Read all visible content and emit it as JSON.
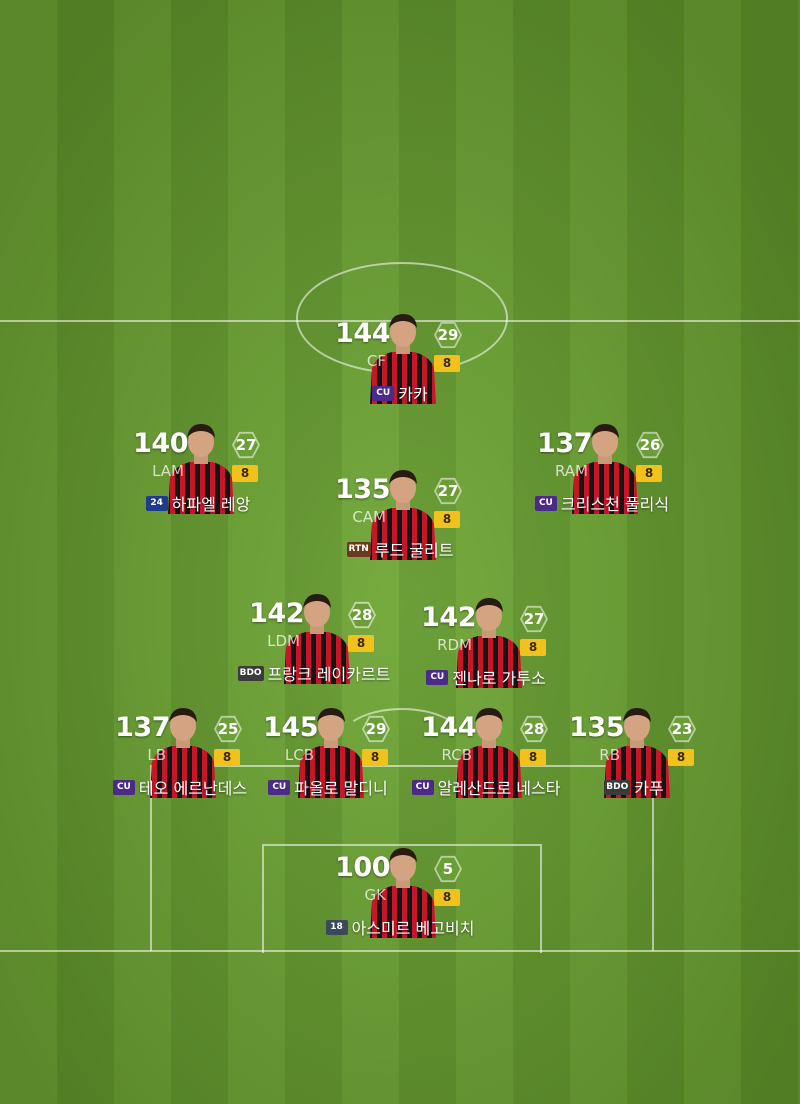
{
  "formation": {
    "players": [
      {
        "slot": "cf",
        "ovr": "144",
        "pos": "CF",
        "level": "29",
        "enhance": "8",
        "badge": "CU",
        "badge_color": "#4b2a8a",
        "name": "카카"
      },
      {
        "slot": "lam",
        "ovr": "140",
        "pos": "LAM",
        "level": "27",
        "enhance": "8",
        "badge": "24",
        "badge_color": "#1e3b8f",
        "name": "하파엘 레앙"
      },
      {
        "slot": "cam",
        "ovr": "135",
        "pos": "CAM",
        "level": "27",
        "enhance": "8",
        "badge": "RTN",
        "badge_color": "#6b3a1e",
        "name": "루드 굴리트"
      },
      {
        "slot": "ram",
        "ovr": "137",
        "pos": "RAM",
        "level": "26",
        "enhance": "8",
        "badge": "CU",
        "badge_color": "#4b2a8a",
        "name": "크리스천 풀리식"
      },
      {
        "slot": "ldm",
        "ovr": "142",
        "pos": "LDM",
        "level": "28",
        "enhance": "8",
        "badge": "BDO",
        "badge_color": "#3b3b3b",
        "name": "프랑크 레이카르트"
      },
      {
        "slot": "rdm",
        "ovr": "142",
        "pos": "RDM",
        "level": "27",
        "enhance": "8",
        "badge": "CU",
        "badge_color": "#4b2a8a",
        "name": "젠나로 가투소"
      },
      {
        "slot": "lb",
        "ovr": "137",
        "pos": "LB",
        "level": "25",
        "enhance": "8",
        "badge": "CU",
        "badge_color": "#4b2a8a",
        "name": "테오 에르난데스"
      },
      {
        "slot": "lcb",
        "ovr": "145",
        "pos": "LCB",
        "level": "29",
        "enhance": "8",
        "badge": "CU",
        "badge_color": "#4b2a8a",
        "name": "파올로 말디니"
      },
      {
        "slot": "rcb",
        "ovr": "144",
        "pos": "RCB",
        "level": "28",
        "enhance": "8",
        "badge": "CU",
        "badge_color": "#4b2a8a",
        "name": "알레산드로 네스타"
      },
      {
        "slot": "rb",
        "ovr": "135",
        "pos": "RB",
        "level": "23",
        "enhance": "8",
        "badge": "BDO",
        "badge_color": "#3b3b3b",
        "name": "카푸"
      },
      {
        "slot": "gk",
        "ovr": "100",
        "pos": "GK",
        "level": "5",
        "enhance": "8",
        "badge": "18",
        "badge_color": "#3a4a5a",
        "name": "아스미르 베고비치"
      }
    ]
  }
}
